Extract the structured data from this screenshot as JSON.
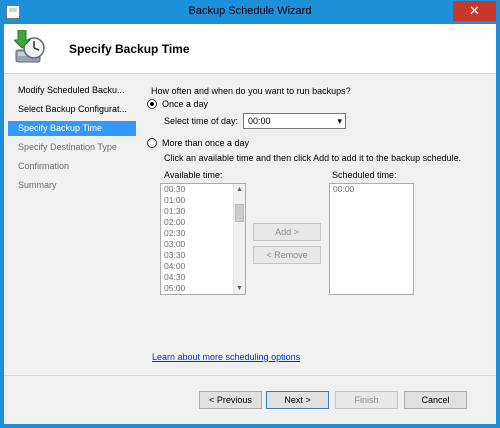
{
  "window": {
    "title": "Backup Schedule Wizard",
    "close_glyph": "✕"
  },
  "header": {
    "heading": "Specify Backup Time"
  },
  "nav": {
    "items": [
      {
        "label": "Modify Scheduled Backu...",
        "state": "normal"
      },
      {
        "label": "Select Backup Configurat...",
        "state": "normal"
      },
      {
        "label": "Specify Backup Time",
        "state": "active"
      },
      {
        "label": "Specify Destination Type",
        "state": "disabled"
      },
      {
        "label": "Confirmation",
        "state": "disabled"
      },
      {
        "label": "Summary",
        "state": "disabled"
      }
    ]
  },
  "content": {
    "question": "How often and when do you want to run backups?",
    "once_label": "Once a day",
    "once_selected": true,
    "time_label": "Select time of day:",
    "time_value": "00:00",
    "more_label": "More than once a day",
    "more_selected": false,
    "instruction": "Click an available time and then click Add to add it to the backup schedule.",
    "available_label": "Available time:",
    "available_times": [
      "00:30",
      "01:00",
      "01:30",
      "02:00",
      "02:30",
      "03:00",
      "03:30",
      "04:00",
      "04:30",
      "05:00"
    ],
    "scheduled_label": "Scheduled time:",
    "scheduled_times": [
      "00:00"
    ],
    "add_label": "Add >",
    "remove_label": "< Remove",
    "link_text": "Learn about more scheduling options"
  },
  "footer": {
    "previous": "< Previous",
    "next": "Next >",
    "finish": "Finish",
    "cancel": "Cancel"
  },
  "colors": {
    "titlebar": "#1e8fd9",
    "nav_active": "#3399ff",
    "close": "#c7382c",
    "link": "#0033cc"
  }
}
